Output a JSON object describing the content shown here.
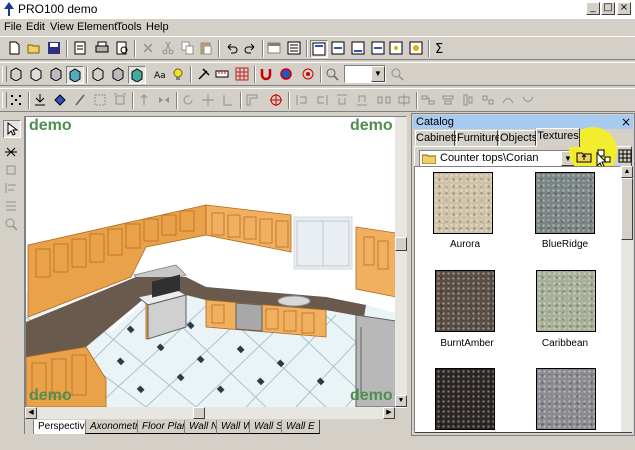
{
  "window": {
    "title": "PRO100 demo"
  },
  "menu": [
    "File",
    "Edit",
    "View",
    "Element",
    "Tools",
    "Help"
  ],
  "viewport": {
    "watermark": "demo"
  },
  "view_tabs": [
    "Perspective",
    "Axonometry",
    "Floor Plan",
    "Wall N",
    "Wall W",
    "Wall S",
    "Wall E"
  ],
  "catalog": {
    "title": "Catalog",
    "close": "×",
    "tabs": [
      "Cabinets",
      "Furniture",
      "Objects",
      "Textures"
    ],
    "active_tab": "Textures",
    "path": "Counter tops\\Corian",
    "textures": [
      {
        "name": "Aurora",
        "color": "#cfc2a6"
      },
      {
        "name": "BlueRidge",
        "color": "#7b8584"
      },
      {
        "name": "BurntAmber",
        "color": "#5a4e44"
      },
      {
        "name": "Caribbean",
        "color": "#a6b096"
      },
      {
        "name": "",
        "color": "#2c2622"
      },
      {
        "name": "",
        "color": "#8c8a90"
      }
    ]
  },
  "colors": {
    "title_active": "#a6caf0",
    "watermark": "#4f8f4f",
    "highlight": "#f5f020"
  },
  "icons": {
    "toolbar1": [
      "new-icon",
      "open-icon",
      "save-icon",
      "properties-icon",
      "print-icon",
      "print-preview-icon",
      "delete-icon",
      "cut-icon",
      "copy-icon",
      "paste-icon",
      "undo-icon",
      "redo-icon",
      "window-icon",
      "list-icon",
      "view-a-icon",
      "view-b-icon",
      "view-c-icon",
      "view-d-icon",
      "view-e-icon",
      "view-f-icon",
      "sigma-icon"
    ],
    "toolbar2": [
      "cube-a-icon",
      "cube-b-icon",
      "cube-c-icon",
      "cube-d-icon",
      "cube-e-icon",
      "cube-f-icon",
      "cube-g-icon",
      "text-icon",
      "light-icon",
      "tools-icon",
      "measure-icon",
      "grid-icon",
      "magnet-icon",
      "snap-icon",
      "target-icon",
      "zoom-in-icon",
      "zoom-out-icon"
    ],
    "toolbar3": [
      "scatter-icon",
      "arrange-icon",
      "move-icon",
      "scale-icon",
      "frame-icon",
      "align-icon",
      "rotate-icon",
      "move-cross-icon",
      "mirror-icon",
      "wall-icon",
      "target2-icon",
      "dist-a-icon",
      "dist-b-icon",
      "dist-c-icon",
      "dist-d-icon",
      "dist-e-icon",
      "dist-f-icon",
      "dist-g-icon",
      "dist-h-icon",
      "dist-i-icon"
    ]
  }
}
